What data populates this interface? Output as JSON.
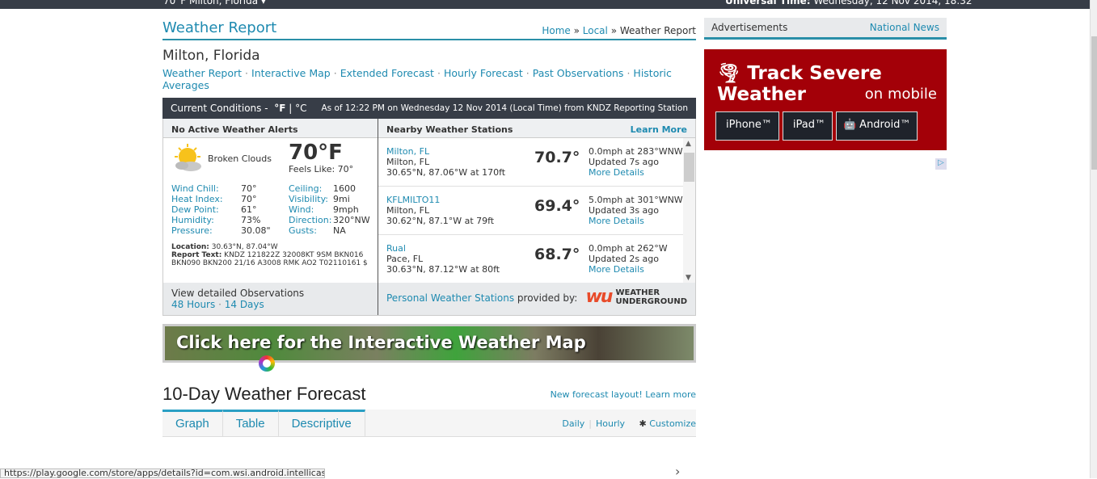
{
  "topbar": {
    "location": "70°F Milton, Florida ▾",
    "utc_label": "Universal Time:",
    "utc_value": "Wednesday, 12 Nov 2014, 18:32"
  },
  "header": {
    "title": "Weather Report",
    "breadcrumb": [
      "Home",
      "Local",
      "Weather Report"
    ],
    "sep": "»"
  },
  "city": "Milton, Florida",
  "subnav": [
    "Weather Report",
    "Interactive Map",
    "Extended Forecast",
    "Hourly Forecast",
    "Past Observations",
    "Historic Averages"
  ],
  "conditions_bar": {
    "label": "Current Conditions -",
    "unit_f": "°F",
    "unit_sep": "|",
    "unit_c": "°C",
    "asof": "As of 12:22 PM on Wednesday 12 Nov 2014 (Local Time) from KNDZ Reporting Station"
  },
  "current": {
    "alerts": "No Active Weather Alerts",
    "icon": "partly-cloudy-sun-icon",
    "description": "Broken Clouds",
    "temp": "70°F",
    "feels_like": "Feels Like: 70°",
    "stats": [
      [
        "Wind Chill:",
        "70°",
        "Ceiling:",
        "1600"
      ],
      [
        "Heat Index:",
        "70°",
        "Visibility:",
        "9mi"
      ],
      [
        "Dew Point:",
        "61°",
        "Wind:",
        "9mph"
      ],
      [
        "Humidity:",
        "73%",
        "Direction:",
        "320°NW"
      ],
      [
        "Pressure:",
        "30.08\"",
        "Gusts:",
        "NA"
      ]
    ],
    "location_label": "Location:",
    "location": "30.63°N, 87.04°W",
    "report_label": "Report Text:",
    "report": "KNDZ 121822Z 32008KT 9SM BKN016 BKN090 BKN200 21/16 A3008 RMK AO2 T02110161 $",
    "observations_label": "View detailed Observations",
    "obs_links": [
      "48 Hours",
      "14 Days"
    ]
  },
  "nearby": {
    "title": "Nearby Weather Stations",
    "learn_more": "Learn More",
    "stations": [
      {
        "name": "Milton, FL",
        "city": "Milton, FL",
        "coords": "30.65°N, 87.06°W at 170ft",
        "temp": "70.7°",
        "wind": "0.0mph at 283°WNW",
        "updated": "Updated 7s ago",
        "details": "More Details"
      },
      {
        "name": "KFLMILTO11",
        "city": "Milton, FL",
        "coords": "30.62°N, 87.1°W at 79ft",
        "temp": "69.4°",
        "wind": "5.0mph at 301°WNW",
        "updated": "Updated 3s ago",
        "details": "More Details"
      },
      {
        "name": "Rual",
        "city": "Pace, FL",
        "coords": "30.63°N, 87.12°W at 80ft",
        "temp": "68.7°",
        "wind": "0.0mph at 262°W",
        "updated": "Updated 2s ago",
        "details": "More Details"
      }
    ],
    "pws_link": "Personal Weather Stations",
    "provided_by": "provided by:",
    "wu_logo": "wu",
    "wu_text1": "WEATHER",
    "wu_text2": "UNDERGROUND"
  },
  "map_banner": "Click here for the  Interactive Weather Map",
  "forecast": {
    "title": "10-Day Weather Forecast",
    "new_layout": "New forecast layout! Learn more",
    "tabs": [
      "Graph",
      "Table",
      "Descriptive"
    ],
    "daily": "Daily",
    "hourly": "Hourly",
    "customize": "Customize"
  },
  "sidebar": {
    "ads": "Advertisements",
    "national_news": "National News",
    "ad_title": "Track Severe Weather",
    "ad_sub": "on mobile",
    "ad_buttons": [
      "iPhone™",
      "iPad™",
      "Android™"
    ],
    "ad_color": "#a30008"
  },
  "status_url": "https://play.google.com/store/apps/details?id=com.wsi.android.intellicast"
}
